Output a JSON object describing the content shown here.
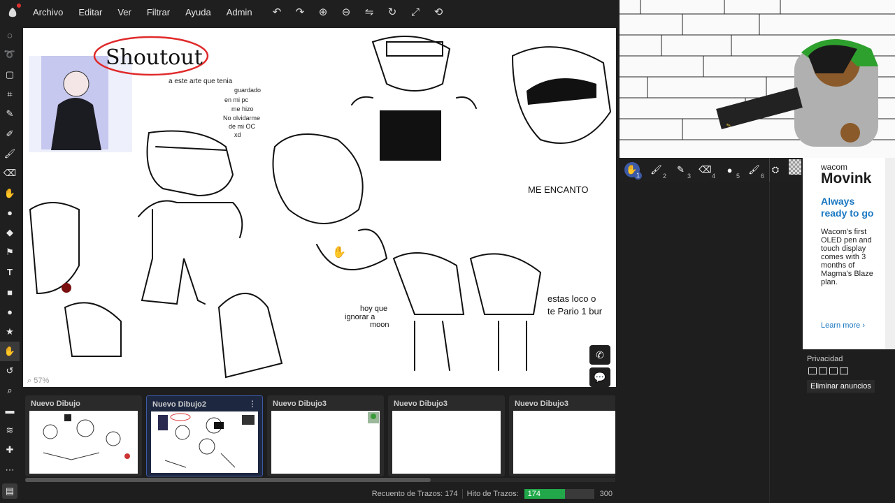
{
  "menu": {
    "items": [
      "Archivo",
      "Editar",
      "Ver",
      "Filtrar",
      "Ayuda",
      "Admin"
    ]
  },
  "toolbar_icons": [
    "undo-icon",
    "redo-icon",
    "zoom-in-icon",
    "zoom-out-icon",
    "flip-icon",
    "rotate-icon",
    "fullscreen-icon",
    "reset-rotate-icon"
  ],
  "left_tools": [
    "lasso-select",
    "free-select",
    "rect-select",
    "crop",
    "eyedropper",
    "pen",
    "brush",
    "eraser",
    "smudge",
    "blend",
    "fill",
    "stamp",
    "text",
    "rectangle",
    "ellipse",
    "shape",
    "hand",
    "rotate",
    "zoom",
    "chat",
    "layers",
    "add"
  ],
  "canvas": {
    "zoom": "57%",
    "texts": {
      "shoutout": "Shoutout",
      "note1": "a este arte que tenia",
      "note2": "guardado",
      "note3": "en mi pc",
      "note4": "me hizo",
      "note5": "No olvidarme",
      "note6": "de mi OC",
      "note7": "xd",
      "me_encanto": "ME ENCANTO",
      "hoy1": "hoy que",
      "hoy2": "ignorar a",
      "hoy3": "moon",
      "estas1": "estas loco o",
      "estas2": "te Pario 1 bur"
    }
  },
  "thumbnails": [
    {
      "label": "Nuevo Dibujo",
      "active": false
    },
    {
      "label": "Nuevo Dibujo2",
      "active": true
    },
    {
      "label": "Nuevo Dibujo3",
      "active": false
    },
    {
      "label": "Nuevo Dibujo3",
      "active": false
    },
    {
      "label": "Nuevo Dibujo3",
      "active": false
    }
  ],
  "status": {
    "stroke_count_label": "Recuento de Trazos: 174",
    "stroke_goal_label": "Hito de Trazos:",
    "current": "174",
    "goal": "300",
    "progress": 0.58
  },
  "brushes": [
    "1",
    "2",
    "3",
    "4",
    "5",
    "6"
  ],
  "ad": {
    "brand": "wacom",
    "product": "Movink",
    "tagline": "Always ready to go",
    "body": "Wacom's first OLED pen and touch display comes with 3 months of Magma's Blaze plan.",
    "cta": "Learn more"
  },
  "privacy": {
    "label": "Privacidad",
    "remove_ads": "Eliminar anuncios"
  }
}
